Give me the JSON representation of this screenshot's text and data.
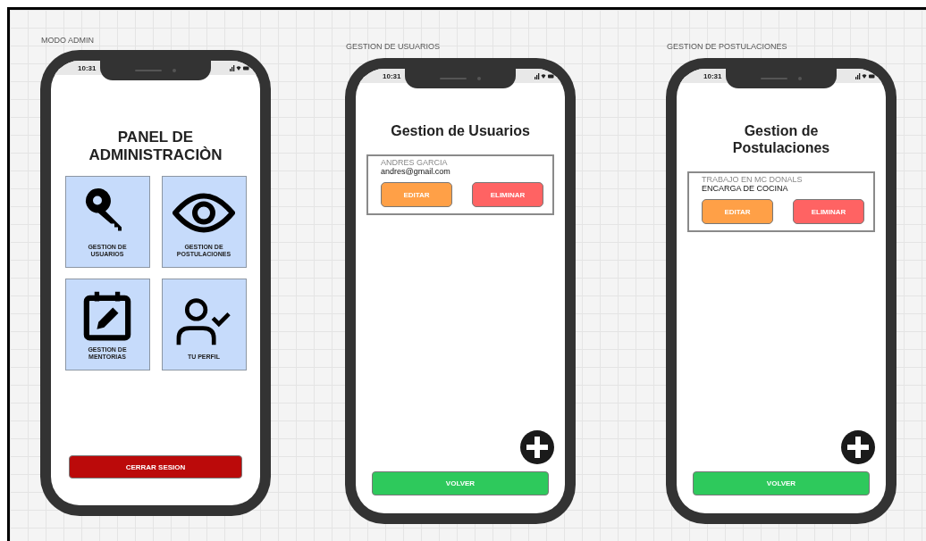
{
  "phones": [
    {
      "caption": "MODO ADMIN",
      "time": "10:31",
      "kind": "admin",
      "title": "PANEL DE ADMINISTRACIÒN",
      "tiles": [
        {
          "label": "GESTION DE USUARIOS"
        },
        {
          "label": "GESTION DE POSTULACIONES"
        },
        {
          "label": "GESTION DE MENTORIAS"
        },
        {
          "label": "TU PERFIL"
        }
      ],
      "button": "CERRAR SESION"
    },
    {
      "caption": "GESTION DE USUARIOS",
      "time": "10:31",
      "kind": "list",
      "title": "Gestion de Usuarios",
      "card": {
        "line_1": "ANDRES GARCIA",
        "line_2": "andres@gmail.com",
        "edit": "EDITAR",
        "delete": "ELIMINAR"
      },
      "button": "VOLVER"
    },
    {
      "caption": "GESTION DE POSTULACIONES",
      "time": "10:31",
      "kind": "list",
      "title": "Gestion de Postulaciones",
      "card": {
        "line_1": "TRABAJO EN MC DONALS",
        "line_2": "ENCARGA DE COCINA",
        "edit": "EDITAR",
        "delete": "ELIMINAR"
      },
      "button": "VOLVER"
    }
  ]
}
